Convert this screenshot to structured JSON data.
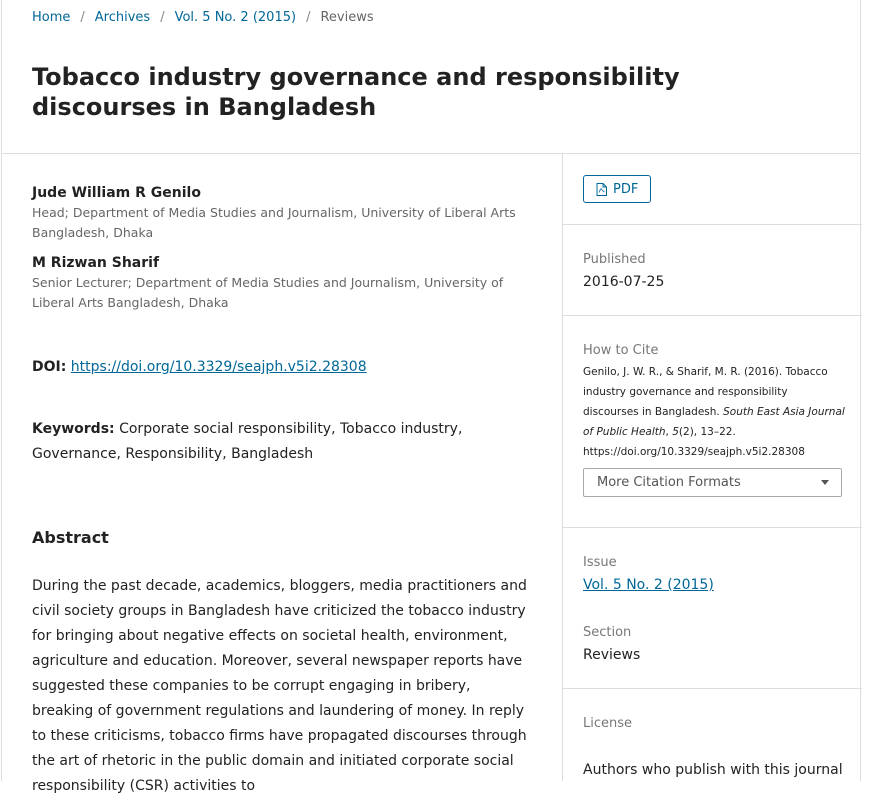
{
  "breadcrumb": {
    "home": "Home",
    "archives": "Archives",
    "issue": "Vol. 5 No. 2 (2015)",
    "current": "Reviews",
    "separator": "/"
  },
  "article": {
    "title": "Tobacco industry governance and responsibility discourses in Bangladesh",
    "authors": [
      {
        "name": "Jude William R Genilo",
        "affiliation": "Head; Department of Media Studies and Journalism, University of Liberal Arts Bangladesh, Dhaka"
      },
      {
        "name": "M Rizwan Sharif",
        "affiliation": "Senior Lecturer; Department of Media Studies and Journalism, University of Liberal Arts Bangladesh, Dhaka"
      }
    ],
    "doi_label": "DOI:",
    "doi_url": "https://doi.org/10.3329/seajph.v5i2.28308",
    "keywords_label": "Keywords:",
    "keywords": "Corporate social responsibility, Tobacco industry, Governance, Responsibility, Bangladesh",
    "abstract_heading": "Abstract",
    "abstract": "During the past decade, academics, bloggers, media practitioners and civil society groups in Bangladesh have criticized the tobacco industry for bringing about negative effects on societal health, environment, agriculture and education. Moreover, several newspaper reports have suggested these companies to be corrupt engaging in bribery, breaking of government regulations and laundering of money. In reply to these criticisms, tobacco firms have propagated discourses through the art of rhetoric in the public domain and initiated corporate social responsibility (CSR) activities to"
  },
  "sidebar": {
    "pdf_label": "PDF",
    "published_label": "Published",
    "published_date": "2016-07-25",
    "cite_label": "How to Cite",
    "cite_text_1": "Genilo, J. W. R., & Sharif, M. R. (2016). Tobacco industry governance and responsibility discourses in Bangladesh. ",
    "cite_journal": "South East Asia Journal of Public Health",
    "cite_comma": ", ",
    "cite_volume": "5",
    "cite_text_2": "(2), 13–22. https://doi.org/10.3329/seajph.v5i2.28308",
    "citation_formats": "More Citation Formats",
    "issue_label": "Issue",
    "issue_link": "Vol. 5 No. 2 (2015)",
    "section_label": "Section",
    "section_value": "Reviews",
    "license_label": "License",
    "license_text": "Authors who publish with this journal"
  },
  "colors": {
    "link": "#006798",
    "border": "#dddddd",
    "muted": "#777777"
  }
}
